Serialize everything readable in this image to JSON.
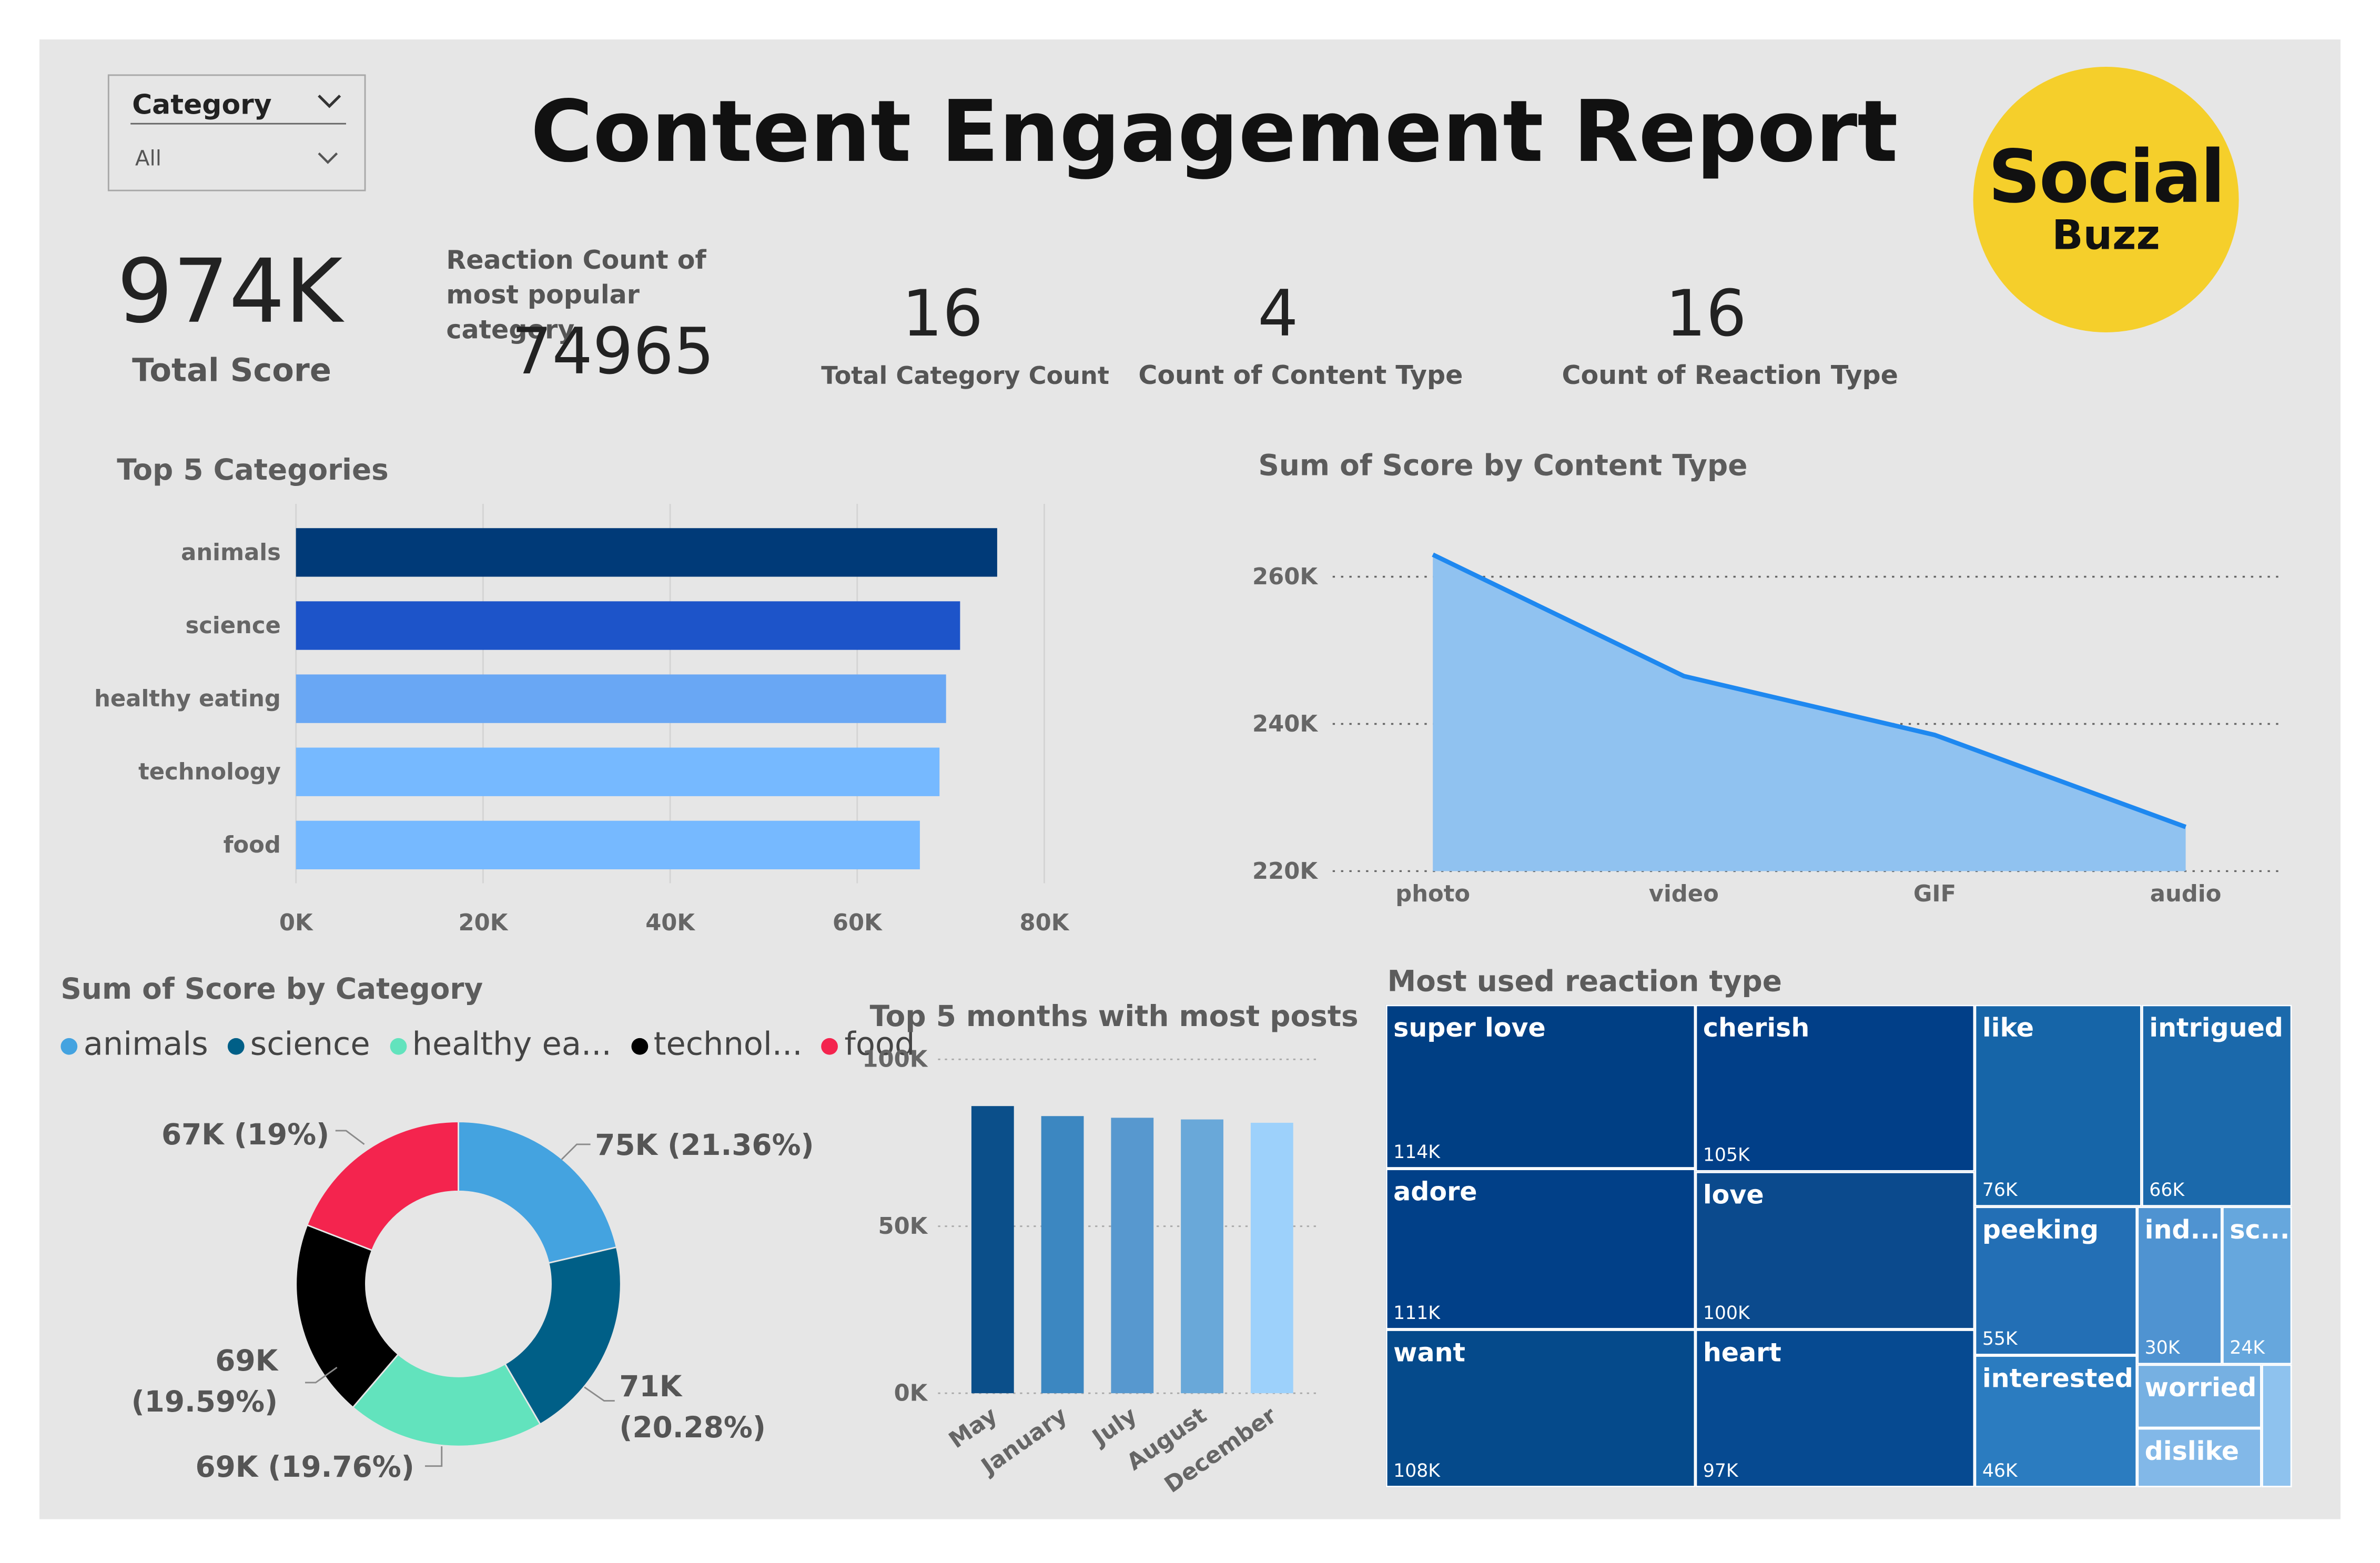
{
  "title": "Content Engagement Report",
  "logo": {
    "line1": "Social",
    "line2": "Buzz",
    "bg": "#f5cf2b"
  },
  "slicer": {
    "label": "Category",
    "value": "All"
  },
  "kpis": {
    "total_score": {
      "value": "974K",
      "label": "Total Score"
    },
    "reaction_count": {
      "label": "Reaction Count of most popular category",
      "value": "74965"
    },
    "category_count": {
      "value": "16",
      "label": "Total Category Count"
    },
    "content_type_count": {
      "value": "4",
      "label": "Count of Content Type"
    },
    "reaction_type_count": {
      "value": "16",
      "label": "Count of Reaction Type"
    }
  },
  "chart_data": [
    {
      "id": "top5",
      "type": "bar",
      "orientation": "horizontal",
      "title": "Top 5 Categories",
      "categories": [
        "animals",
        "science",
        "healthy eating",
        "technology",
        "food"
      ],
      "values": [
        74965,
        71000,
        69500,
        68800,
        66700
      ],
      "colors": [
        "#003a78",
        "#1d54c9",
        "#69a7f4",
        "#76b9ff",
        "#76b9ff"
      ],
      "xlim": [
        0,
        80000
      ],
      "xticks": [
        "0K",
        "20K",
        "40K",
        "60K",
        "80K"
      ],
      "xtick_values": [
        0,
        20000,
        40000,
        60000,
        80000
      ],
      "grid": true
    },
    {
      "id": "content_type",
      "type": "area",
      "title": "Sum of Score by Content Type",
      "categories": [
        "photo",
        "video",
        "GIF",
        "audio"
      ],
      "values": [
        263000,
        246500,
        238500,
        226000
      ],
      "ylim": [
        220000,
        260000
      ],
      "yticks": [
        "260K",
        "240K",
        "220K"
      ],
      "ytick_values": [
        260000,
        240000,
        220000
      ],
      "line_color": "#1e88f0",
      "fill_color": "#90c2f0",
      "grid": true
    },
    {
      "id": "by_category",
      "type": "pie",
      "donut": true,
      "title": "Sum of Score by Category",
      "legend": [
        "animals",
        "science",
        "healthy ea...",
        "technol...",
        "food"
      ],
      "values": [
        75,
        71,
        69,
        69,
        67
      ],
      "percents": [
        21.36,
        20.28,
        19.76,
        19.59,
        19.0
      ],
      "colors": [
        "#44a3e0",
        "#005f87",
        "#62e3bd",
        "#000000",
        "#f4244e"
      ],
      "labels": [
        "75K (21.36%)",
        "71K (20.28%)",
        "69K (19.76%)",
        "69K (19.59%)",
        "67K (19%)"
      ]
    },
    {
      "id": "months",
      "type": "bar",
      "title": "Top 5 months with most posts",
      "categories": [
        "May",
        "January",
        "July",
        "August",
        "December"
      ],
      "values": [
        86000,
        83000,
        82500,
        82000,
        81000
      ],
      "colors": [
        "#0b4f8a",
        "#3c87c1",
        "#5798cf",
        "#69a8d9",
        "#9dd1fb"
      ],
      "ylim": [
        0,
        100000
      ],
      "yticks": [
        "100K",
        "50K",
        "0K"
      ],
      "ytick_values": [
        100000,
        50000,
        0
      ],
      "grid": true
    },
    {
      "id": "reactions",
      "type": "treemap",
      "title": "Most used reaction type",
      "items": [
        {
          "name": "super love",
          "value": "114K"
        },
        {
          "name": "adore",
          "value": "111K"
        },
        {
          "name": "want",
          "value": "108K"
        },
        {
          "name": "cherish",
          "value": "105K"
        },
        {
          "name": "love",
          "value": "100K"
        },
        {
          "name": "heart",
          "value": "97K"
        },
        {
          "name": "like",
          "value": "76K"
        },
        {
          "name": "intrigued",
          "value": "66K"
        },
        {
          "name": "peeking",
          "value": "55K"
        },
        {
          "name": "interested",
          "value": "46K"
        },
        {
          "name": "ind...",
          "value": "30K"
        },
        {
          "name": "sc...",
          "value": "24K"
        },
        {
          "name": "worried",
          "value": ""
        },
        {
          "name": "dislike",
          "value": ""
        },
        {
          "name": "",
          "value": ""
        }
      ]
    }
  ]
}
